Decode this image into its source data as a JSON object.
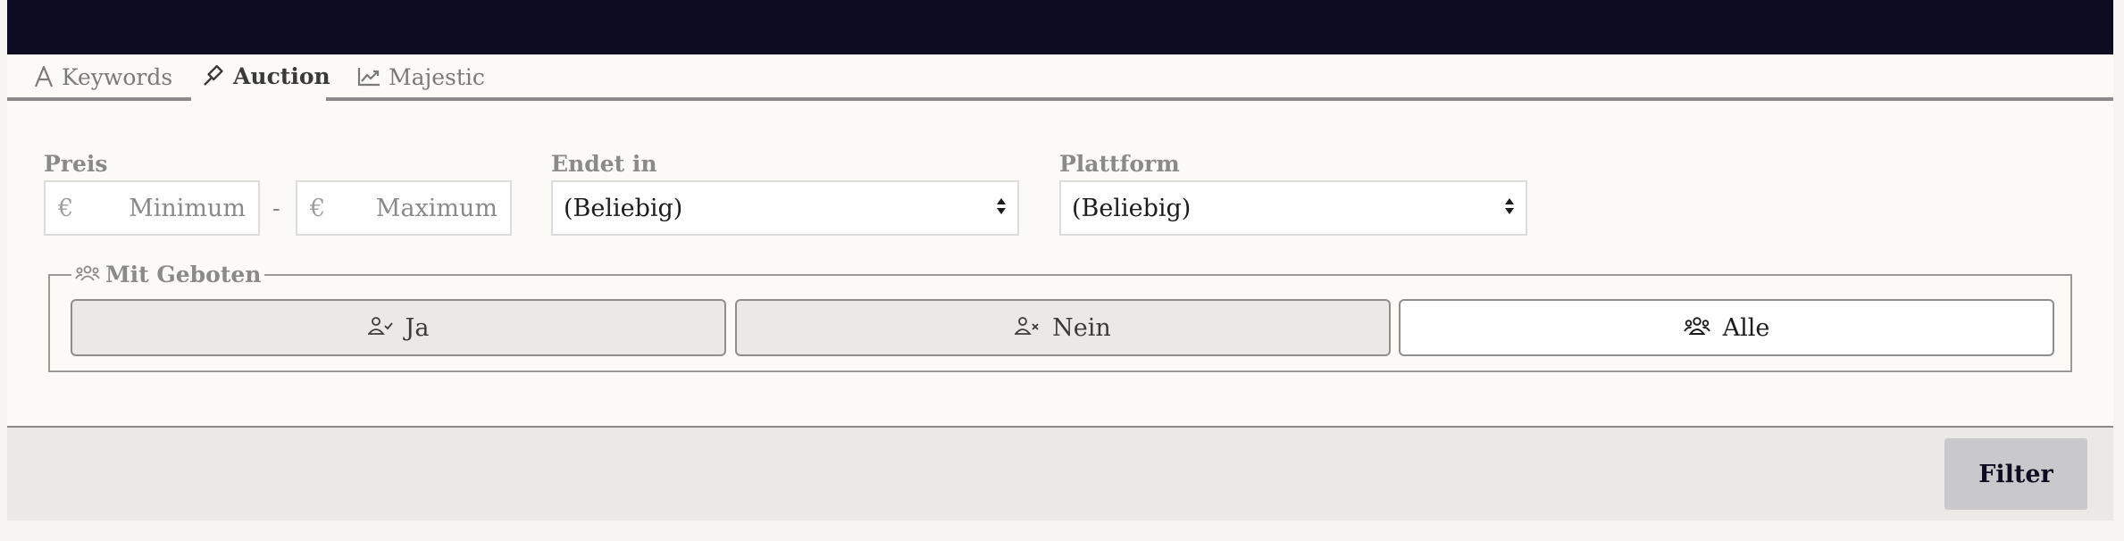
{
  "tabs": [
    {
      "label": "Keywords",
      "icon": "font-icon"
    },
    {
      "label": "Auction",
      "icon": "gavel-icon"
    },
    {
      "label": "Majestic",
      "icon": "chart-line-icon"
    }
  ],
  "active_tab": "Auction",
  "price": {
    "label": "Preis",
    "currency": "€",
    "min_placeholder": "Minimum",
    "max_placeholder": "Maximum",
    "separator": "-"
  },
  "ends_in": {
    "label": "Endet in",
    "selected": "(Beliebig)"
  },
  "platform": {
    "label": "Plattform",
    "selected": "(Beliebig)"
  },
  "bids": {
    "legend": "Mit Geboten",
    "options": [
      {
        "label": "Ja",
        "icon": "user-check-icon"
      },
      {
        "label": "Nein",
        "icon": "user-x-icon"
      },
      {
        "label": "Alle",
        "icon": "users-icon"
      }
    ],
    "selected": "Alle"
  },
  "footer": {
    "filter_label": "Filter"
  },
  "colors": {
    "topbar": "#0d0c22",
    "footer_bg": "#ebe9e5",
    "filter_button": "#c9c8cb"
  }
}
